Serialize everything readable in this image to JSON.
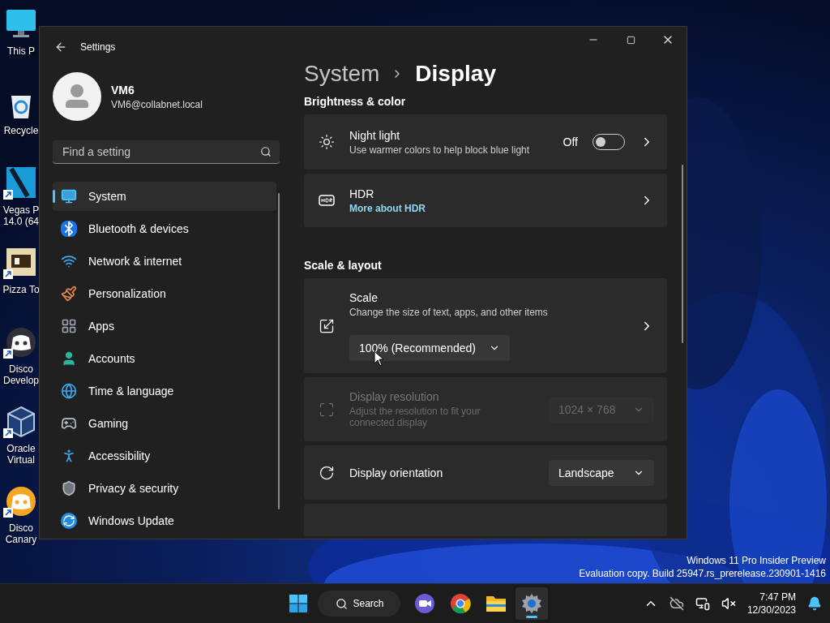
{
  "desktop_icons": [
    {
      "kind": "monitor",
      "shortcut": false,
      "lines": [
        "This P"
      ]
    },
    {
      "kind": "recycle",
      "shortcut": false,
      "lines": [
        "Recycle"
      ]
    },
    {
      "kind": "video",
      "shortcut": true,
      "lines": [
        "Vegas P",
        "14.0 (64"
      ]
    },
    {
      "kind": "game",
      "shortcut": true,
      "lines": [
        "Pizza To"
      ]
    },
    {
      "kind": "chat",
      "shortcut": true,
      "lines": [
        "Disco",
        "Develop"
      ]
    },
    {
      "kind": "cube",
      "shortcut": true,
      "lines": [
        "Oracle",
        "Virtual"
      ]
    },
    {
      "kind": "chat_orange",
      "shortcut": true,
      "lines": [
        "Disco",
        "Canary"
      ]
    }
  ],
  "window": {
    "title": "Settings",
    "user": {
      "name": "VM6",
      "email": "VM6@collabnet.local"
    },
    "search": {
      "placeholder": "Find a setting"
    },
    "nav": [
      {
        "kind": "system",
        "label": "System",
        "selected": true
      },
      {
        "kind": "bluetooth",
        "label": "Bluetooth & devices",
        "selected": false
      },
      {
        "kind": "network",
        "label": "Network & internet",
        "selected": false
      },
      {
        "kind": "personalization",
        "label": "Personalization",
        "selected": false
      },
      {
        "kind": "apps",
        "label": "Apps",
        "selected": false
      },
      {
        "kind": "accounts",
        "label": "Accounts",
        "selected": false
      },
      {
        "kind": "time",
        "label": "Time & language",
        "selected": false
      },
      {
        "kind": "gaming",
        "label": "Gaming",
        "selected": false
      },
      {
        "kind": "accessibility",
        "label": "Accessibility",
        "selected": false
      },
      {
        "kind": "privacy",
        "label": "Privacy & security",
        "selected": false
      },
      {
        "kind": "update",
        "label": "Windows Update",
        "selected": false
      }
    ],
    "breadcrumb": [
      "System",
      "Display"
    ],
    "sections": [
      {
        "title": "Brightness & color",
        "cards": [
          {
            "kind": "toggle",
            "title": "Night light",
            "description": "Use warmer colors to help block blue light",
            "state_label": "Off",
            "on": false,
            "disabled": false
          },
          {
            "kind": "link",
            "title": "HDR",
            "link": "More about HDR",
            "disabled": false
          }
        ]
      },
      {
        "title": "Scale & layout",
        "cards": [
          {
            "kind": "scale",
            "title": "Scale",
            "description": "Change the size of text, apps, and other items",
            "value": "100% (Recommended)",
            "disabled": false
          },
          {
            "kind": "dropdown",
            "title": "Display resolution",
            "description": "Adjust the resolution to fit your connected display",
            "value": "1024 × 768",
            "disabled": true
          },
          {
            "kind": "dropdown",
            "title": "Display orientation",
            "value": "Landscape",
            "disabled": false
          }
        ]
      }
    ]
  },
  "watermark": [
    "Windows 11 Pro Insider Preview",
    "Evaluation copy. Build 25947.rs_prerelease.230901-1416"
  ],
  "taskbar": {
    "search": "Search",
    "apps": [
      {
        "kind": "meet",
        "active": false
      },
      {
        "kind": "browser",
        "active": false
      },
      {
        "kind": "folder",
        "active": false
      },
      {
        "kind": "settings",
        "active": true
      }
    ],
    "time": "7:47 PM",
    "date": "12/30/2023"
  }
}
